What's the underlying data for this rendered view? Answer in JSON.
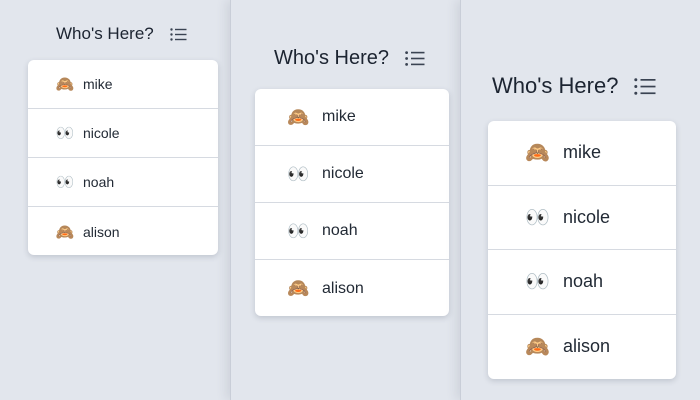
{
  "header": {
    "title": "Who's Here?",
    "icon": "list-icon"
  },
  "members": [
    {
      "name": "mike",
      "status_icon": "see-no-evil-monkey-icon",
      "emoji": "🙈"
    },
    {
      "name": "nicole",
      "status_icon": "eyes-icon",
      "emoji": "👀"
    },
    {
      "name": "noah",
      "status_icon": "eyes-icon",
      "emoji": "👀"
    },
    {
      "name": "alison",
      "status_icon": "see-no-evil-monkey-icon",
      "emoji": "🙈"
    }
  ],
  "colors": {
    "background": "#e3e7ee",
    "card": "#ffffff",
    "text": "#1c2431",
    "divider": "#d6dae1",
    "icon": "#3a4352"
  }
}
